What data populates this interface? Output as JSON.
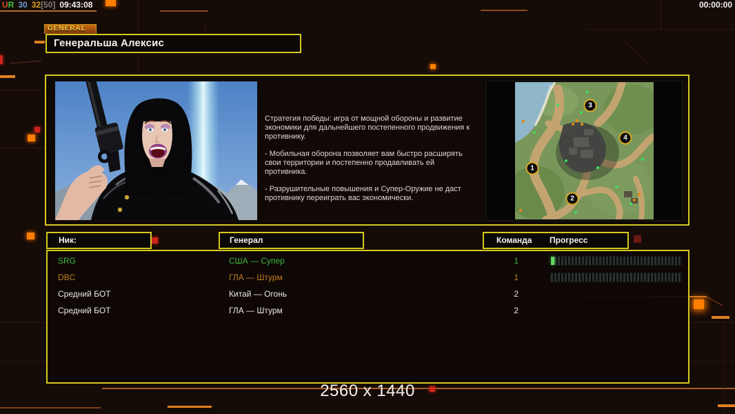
{
  "status_bar": {
    "label_u": "U",
    "label_r": "R",
    "value_blue": "30",
    "value_yellow": "32",
    "value_bracket": "[50]",
    "clock_left": "09:43:08",
    "clock_right": "00:00:00"
  },
  "general_tab": {
    "label": "GENERAL"
  },
  "general": {
    "name": "Генеральша Алексис",
    "strategy_p1": "Стратегия победы: игра от мощной обороны и развитие экономики для дальнейшего постепенного продвижения к противнику.",
    "strategy_p2": "- Мобильная оборона позволяет вам быстро расширять свои территории и постепенно продавливать ей противника.",
    "strategy_p3": "- Разрушительные повышения и Супер-Оружие не даст противнику переиграть вас экономически."
  },
  "map_preview": {
    "markers": [
      "1",
      "2",
      "3",
      "4"
    ]
  },
  "player_table": {
    "headers": {
      "nick": "Ник:",
      "general": "Генерал",
      "team": "Команда",
      "progress": "Прогресс"
    },
    "rows": [
      {
        "nick": "SRG",
        "general": "США — Супер",
        "team": "1"
      },
      {
        "nick": "DBC",
        "general": "ГЛА — Штурм",
        "team": "1"
      },
      {
        "nick": "Средний БОТ",
        "general": "Китай — Огонь",
        "team": "2"
      },
      {
        "nick": "Средний БОТ",
        "general": "ГЛА — Штурм",
        "team": "2"
      }
    ]
  },
  "footer": {
    "resolution": "2560 x 1440"
  },
  "colors": {
    "accent_yellow": "#d6ca22",
    "accent_orange": "#ff7f00",
    "player1_green": "#3cb840",
    "player2_orange": "#c27c1e",
    "bot_white": "#e8e8e8"
  }
}
